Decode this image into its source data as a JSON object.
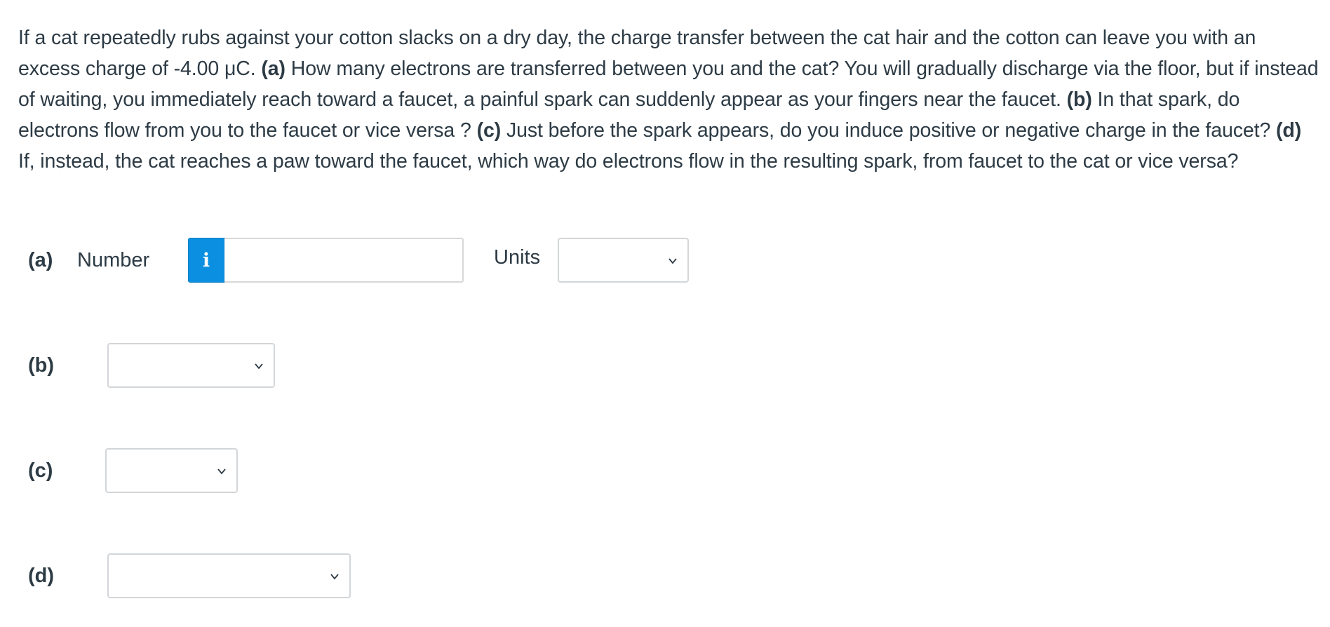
{
  "question": {
    "intro": "If a cat repeatedly rubs against your cotton slacks on a dry day, the charge transfer between the cat hair and the cotton can leave you with an excess charge of -4.00 μC.",
    "part_a_label": "(a)",
    "part_a_text": "How many electrons are transferred between you and the cat? You will gradually discharge via the floor, but if instead of waiting, you immediately reach toward a faucet, a painful spark can suddenly appear as your fingers near the faucet.",
    "part_b_label": "(b)",
    "part_b_text": "In that spark, do electrons flow from you to the faucet or vice versa ?",
    "part_c_label": "(c)",
    "part_c_text": "Just before the spark appears, do you induce positive or negative charge in the faucet?",
    "part_d_label": "(d)",
    "part_d_text": "If, instead, the cat reaches a paw toward the faucet, which way do electrons flow in the resulting spark, from faucet to the cat or vice versa?"
  },
  "answers": {
    "a": {
      "label": "(a)",
      "number_label": "Number",
      "info_icon": "i",
      "number_value": "",
      "units_label": "Units",
      "units_selected": ""
    },
    "b": {
      "label": "(b)",
      "selected": ""
    },
    "c": {
      "label": "(c)",
      "selected": ""
    },
    "d": {
      "label": "(d)",
      "selected": ""
    }
  },
  "icons": {
    "info": "info-icon",
    "dropdown": "chevron-down-icon"
  },
  "colors": {
    "text": "#2d3b45",
    "info_button": "#0b8fe0",
    "border": "#d3d6d9"
  }
}
